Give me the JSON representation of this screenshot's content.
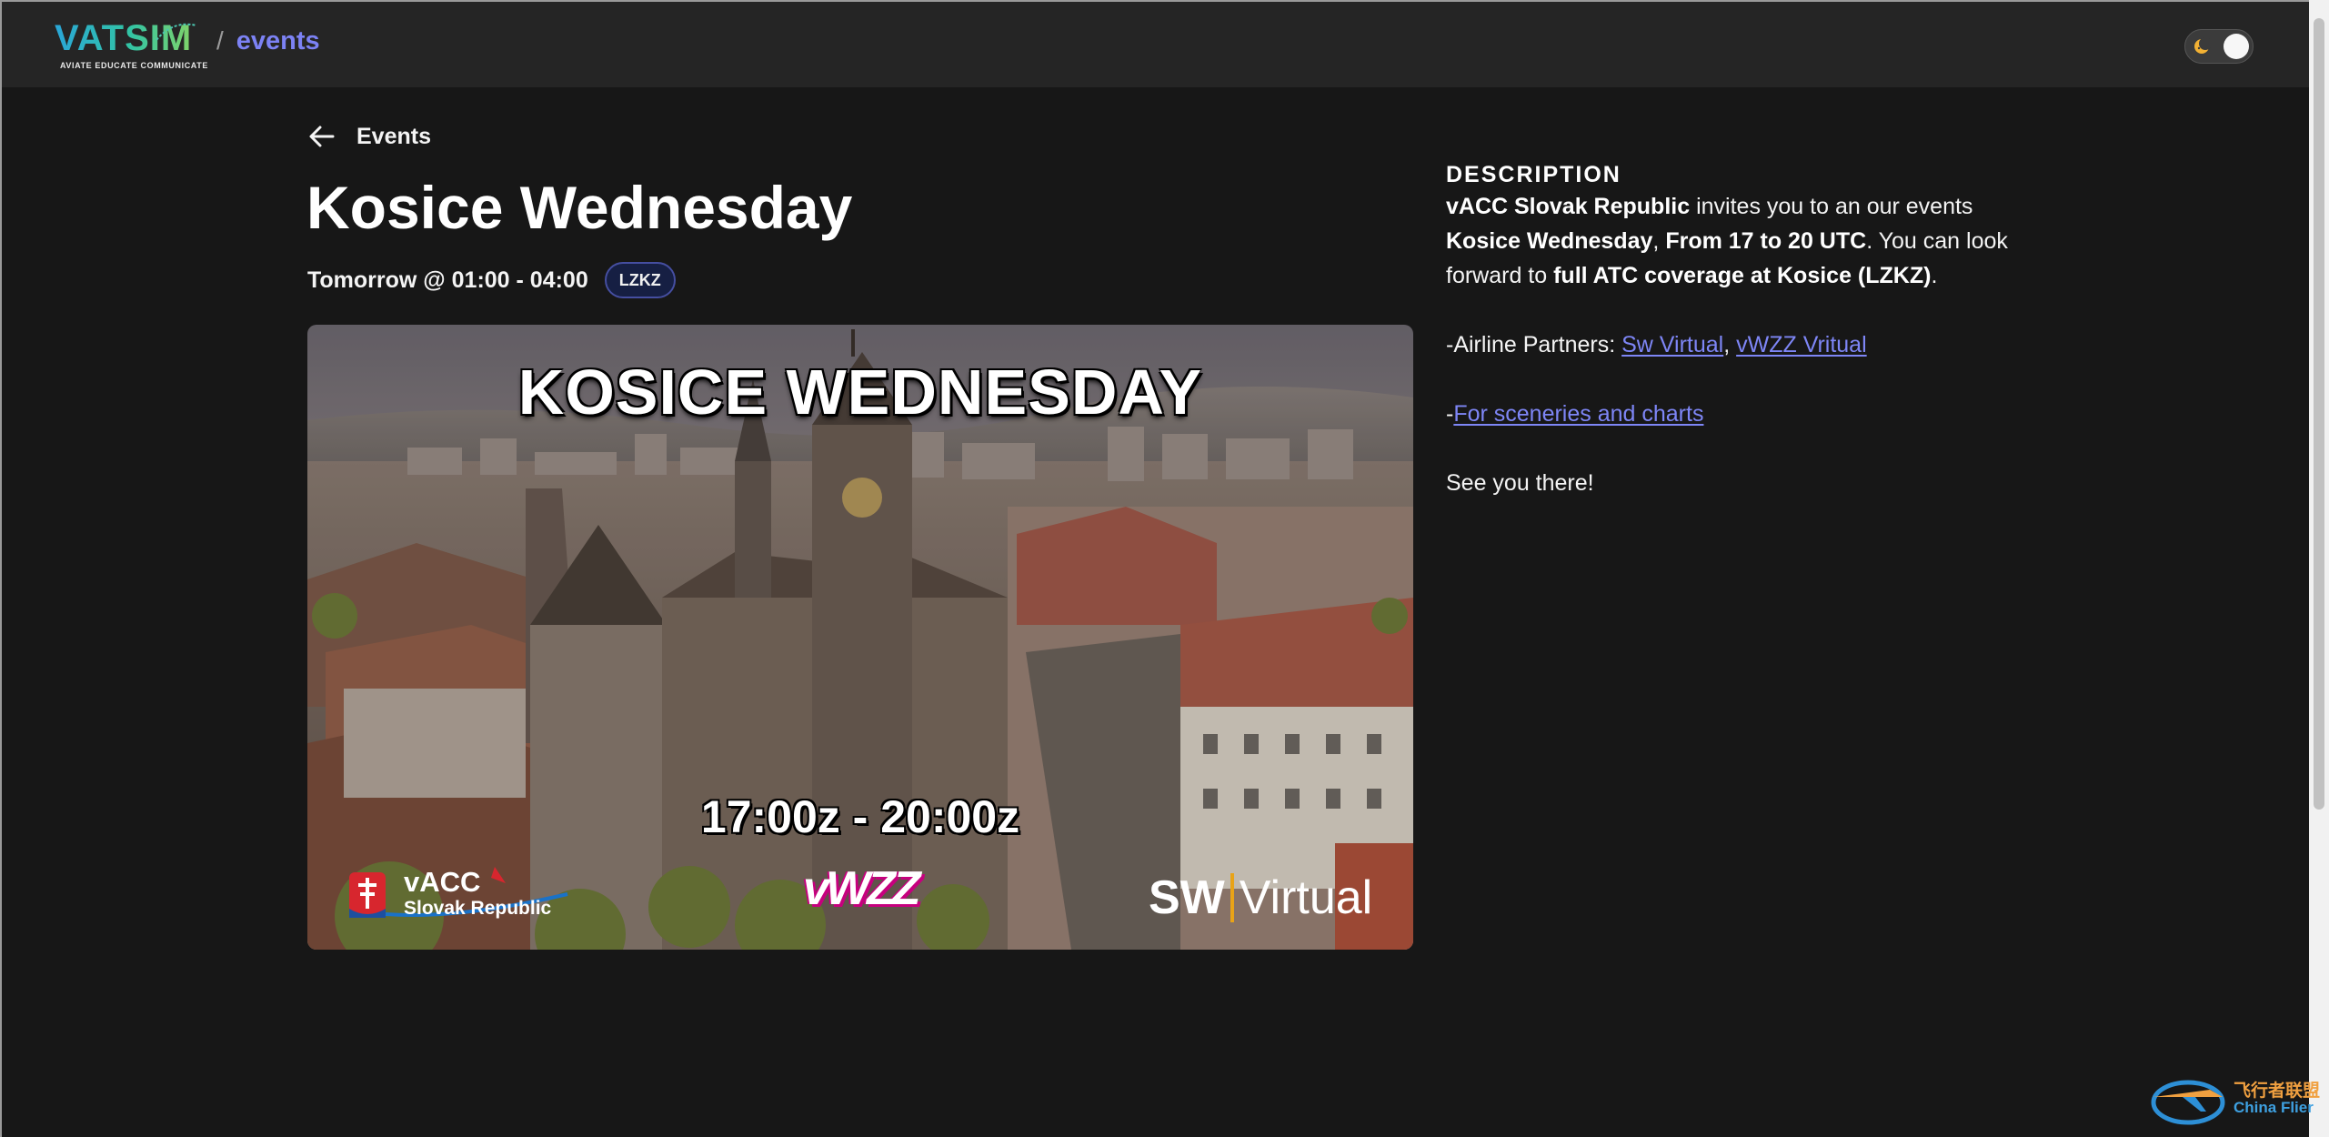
{
  "header": {
    "logo_text": "VATSIM",
    "logo_tagline": "AVIATE  EDUCATE  COMMUNICATE",
    "separator": "/",
    "section": "events",
    "theme_toggle_icon": "moon-icon"
  },
  "nav": {
    "back_label": "Events",
    "back_icon": "arrow-left-icon"
  },
  "event": {
    "title": "Kosice Wednesday",
    "time": "Tomorrow @ 01:00 - 04:00",
    "airport": "LZKZ"
  },
  "banner": {
    "headline": "KOSICE WEDNESDAY",
    "time": "17:00z - 20:00z",
    "vacc_word": "vACC",
    "vacc_sub": "Slovak Republic",
    "wizz_logo": "vWZZ",
    "sw_bold": "SW",
    "sw_rest": "Virtual"
  },
  "description": {
    "heading": "DESCRIPTION",
    "p1_b1": "vACC Slovak Republic",
    "p1_t1": " invites you to an our events ",
    "p1_b2": "Kosice Wednesday",
    "p1_t2": ", ",
    "p1_b3": "From 17 to 20 UTC",
    "p1_t3": ". You can look forward to ",
    "p1_b4": "full ATC coverage at Kosice (LZKZ)",
    "p1_t4": ".",
    "partners_prefix": "-Airline Partners: ",
    "partner_1": "Sw Virtual",
    "partner_sep": ", ",
    "partner_2": "vWZZ Vritual",
    "charts_prefix": "-",
    "charts_link": "For sceneries and charts",
    "closing": "See you there!"
  },
  "watermark": {
    "cn": "飞行者联盟",
    "en": "China Flier"
  },
  "colors": {
    "background": "#171717",
    "header": "#252525",
    "accent": "#7c82f4",
    "badge_bg": "#161f43",
    "badge_border": "#454ea0"
  }
}
